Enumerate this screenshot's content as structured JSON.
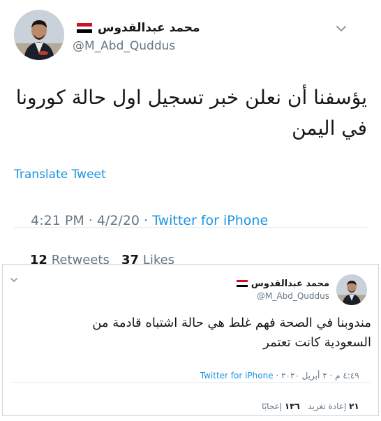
{
  "main_tweet": {
    "display_name": "محمد عبدالقدوس",
    "handle": "@M_Abd_Quddus",
    "text_line1": "يؤسفنا أن نعلن خبر تسجيل اول حالة كورونا",
    "text_line2": "في اليمن",
    "translate_label": "Translate Tweet",
    "timestamp": "4:21 PM · 4/2/20 · ",
    "source": "Twitter for iPhone",
    "retweets_count": "12",
    "retweets_label": "Retweets",
    "likes_count": "37",
    "likes_label": "Likes"
  },
  "quoted_tweet": {
    "display_name": "محمد عبدالقدوس",
    "handle": "@M_Abd_Quddus",
    "text_line1": "مندوبنا في الصحة فهم غلط هي حالة اشتباه قادمة من",
    "text_line2": "السعودية كانت تعتمر",
    "timestamp": "٤:٤٩ م · ٢ أبريل ٢٠٢٠ · ",
    "source": "Twitter for iPhone",
    "retweets_count": "٢١",
    "retweets_label": "إعادة تغريد",
    "likes_count": "١٣٦",
    "likes_label": "إعجابًا"
  },
  "colors": {
    "flag_red": "#ce1126",
    "flag_white": "#ffffff",
    "flag_black": "#000000",
    "link_blue": "#1b95e0",
    "muted_gray": "#657786"
  }
}
